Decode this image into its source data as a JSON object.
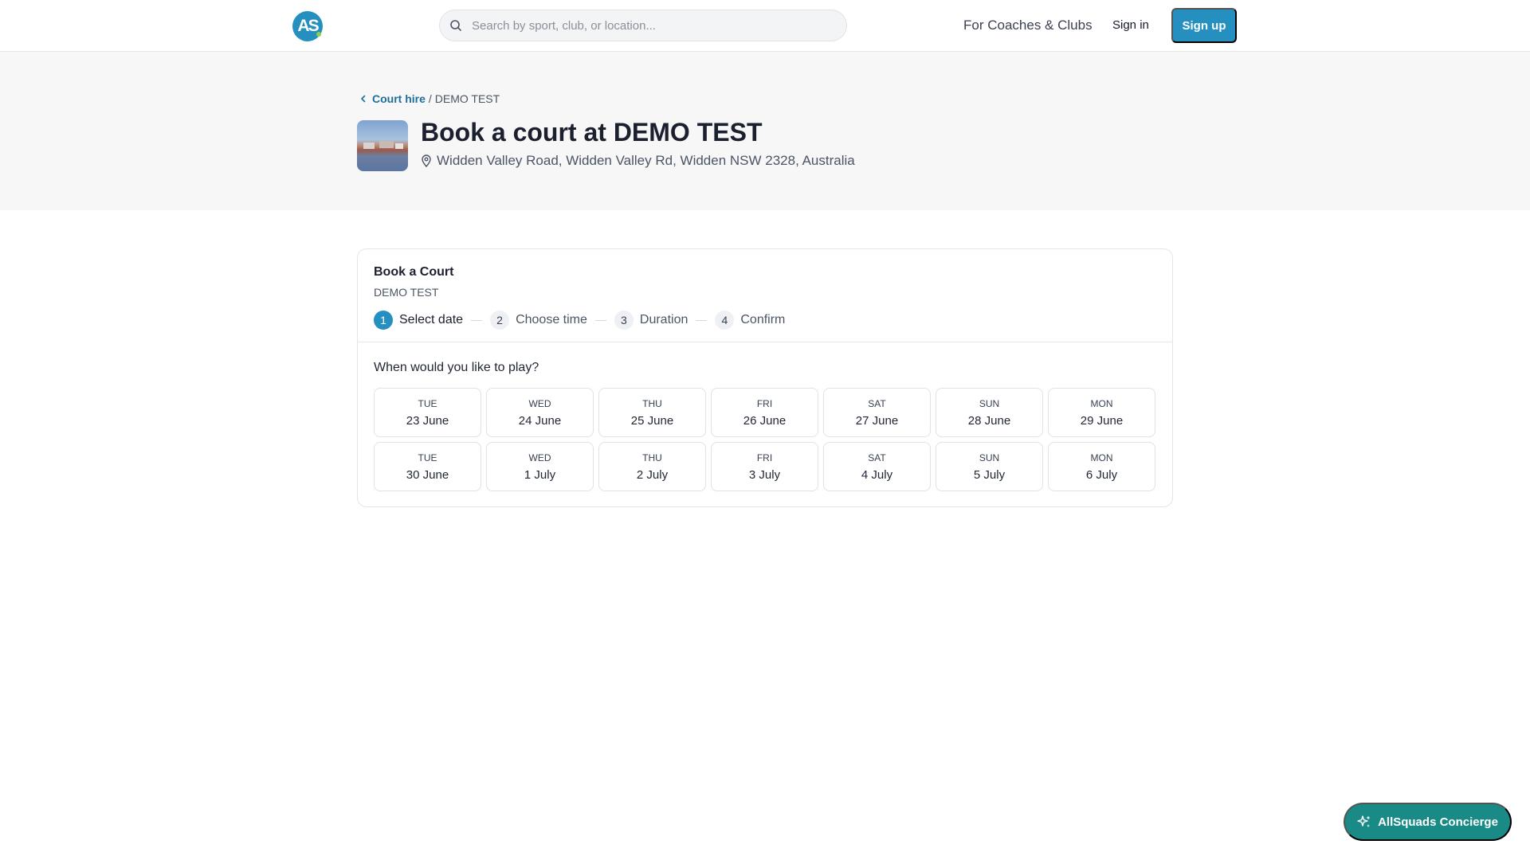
{
  "header": {
    "logo_text": "AS",
    "search_placeholder": "Search by sport, club, or location...",
    "nav_coaches": "For Coaches & Clubs",
    "sign_in": "Sign in",
    "sign_up": "Sign up",
    "brand_color": "#2590c0"
  },
  "hero": {
    "breadcrumb_link": "Court hire",
    "breadcrumb_separator": "/",
    "breadcrumb_current": "DEMO TEST",
    "title": "Book a court at DEMO TEST",
    "address": "Widden Valley Road, Widden Valley Rd, Widden NSW 2328, Australia"
  },
  "booking": {
    "title": "Book a Court",
    "venue": "DEMO TEST",
    "steps": [
      {
        "num": "1",
        "label": "Select date",
        "active": true
      },
      {
        "num": "2",
        "label": "Choose time",
        "active": false
      },
      {
        "num": "3",
        "label": "Duration",
        "active": false
      },
      {
        "num": "4",
        "label": "Confirm",
        "active": false
      }
    ],
    "question": "When would you like to play?",
    "dates": [
      {
        "dow": "TUE",
        "day": "23 June"
      },
      {
        "dow": "WED",
        "day": "24 June"
      },
      {
        "dow": "THU",
        "day": "25 June"
      },
      {
        "dow": "FRI",
        "day": "26 June"
      },
      {
        "dow": "SAT",
        "day": "27 June"
      },
      {
        "dow": "SUN",
        "day": "28 June"
      },
      {
        "dow": "MON",
        "day": "29 June"
      },
      {
        "dow": "TUE",
        "day": "30 June"
      },
      {
        "dow": "WED",
        "day": "1 July"
      },
      {
        "dow": "THU",
        "day": "2 July"
      },
      {
        "dow": "FRI",
        "day": "3 July"
      },
      {
        "dow": "SAT",
        "day": "4 July"
      },
      {
        "dow": "SUN",
        "day": "5 July"
      },
      {
        "dow": "MON",
        "day": "6 July"
      }
    ]
  },
  "concierge": {
    "label": "AllSquads Concierge",
    "color": "#1a8a86"
  },
  "icons": {
    "search": "search-icon",
    "back": "chevron-left-icon",
    "location": "map-pin-icon",
    "concierge": "sparkles-icon"
  }
}
